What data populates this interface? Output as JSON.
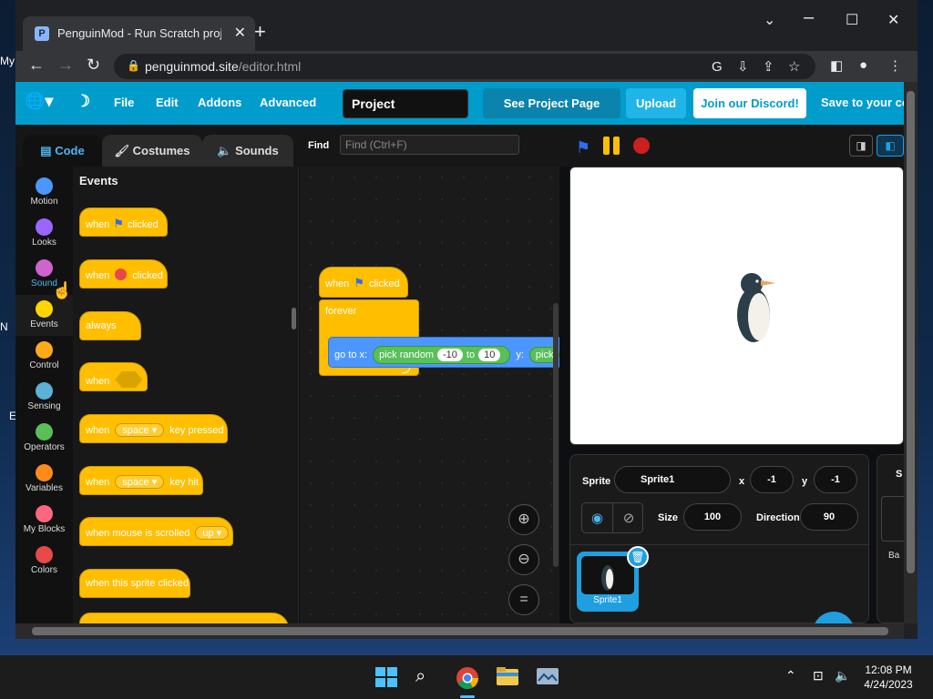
{
  "desktop": {
    "labels": [
      "My",
      "N",
      "E"
    ]
  },
  "browser": {
    "tab_title": "PenguinMod - Run Scratch proje",
    "tab_close": "✕",
    "new_tab": "+",
    "url_host": "penguinmod.site",
    "url_path": "/editor.html",
    "controls": {
      "minimize": "⌄",
      "restore": "☐",
      "close": "✕"
    }
  },
  "menubar": {
    "file": "File",
    "edit": "Edit",
    "addons": "Addons",
    "advanced": "Advanced",
    "project_title": "Project",
    "see_project": "See Project Page",
    "upload": "Upload",
    "discord": "Join our Discord!",
    "save": "Save to your co"
  },
  "tabs": {
    "code": "Code",
    "costumes": "Costumes",
    "sounds": "Sounds"
  },
  "find": {
    "label": "Find",
    "placeholder": "Find (Ctrl+F)"
  },
  "categories": [
    {
      "label": "Motion",
      "color": "#4c97ff"
    },
    {
      "label": "Looks",
      "color": "#9966ff"
    },
    {
      "label": "Sound",
      "color": "#cf63cf"
    },
    {
      "label": "Events",
      "color": "#ffd500"
    },
    {
      "label": "Control",
      "color": "#ffab19"
    },
    {
      "label": "Sensing",
      "color": "#5cb1d6"
    },
    {
      "label": "Operators",
      "color": "#59c059"
    },
    {
      "label": "Variables",
      "color": "#ff8c1a"
    },
    {
      "label": "My Blocks",
      "color": "#ff6680"
    },
    {
      "label": "Colors",
      "color": "#e64a4a"
    }
  ],
  "flyout": {
    "heading": "Events",
    "b1": {
      "a": "when",
      "b": "clicked"
    },
    "b2": {
      "a": "when",
      "b": "clicked"
    },
    "b3": {
      "a": "always"
    },
    "b4": {
      "a": "when"
    },
    "b5": {
      "a": "when",
      "pill": "space ▾",
      "b": "key pressed"
    },
    "b6": {
      "a": "when",
      "pill": "space ▾",
      "b": "key hit"
    },
    "b7": {
      "a": "when mouse is scrolled",
      "pill": "up ▾"
    },
    "b8": {
      "a": "when this sprite clicked"
    }
  },
  "script": {
    "hat_a": "when",
    "hat_b": "clicked",
    "forever": "forever",
    "goto": "go to x:",
    "pick": "pick random",
    "from": "-10",
    "to_word": "to",
    "to": "10",
    "y": "y:",
    "pick2": "pick"
  },
  "sprite": {
    "label": "Sprite",
    "name": "Sprite1",
    "x_label": "x",
    "x": "-1",
    "y_label": "y",
    "y": "-1",
    "size_label": "Size",
    "size": "100",
    "direction_label": "Direction",
    "direction": "90",
    "thumb_name": "Sprite1"
  },
  "stage_pane": {
    "s": "S",
    "ba": "Ba"
  },
  "taskbar": {
    "time": "12:08 PM",
    "date": "4/24/2023"
  }
}
